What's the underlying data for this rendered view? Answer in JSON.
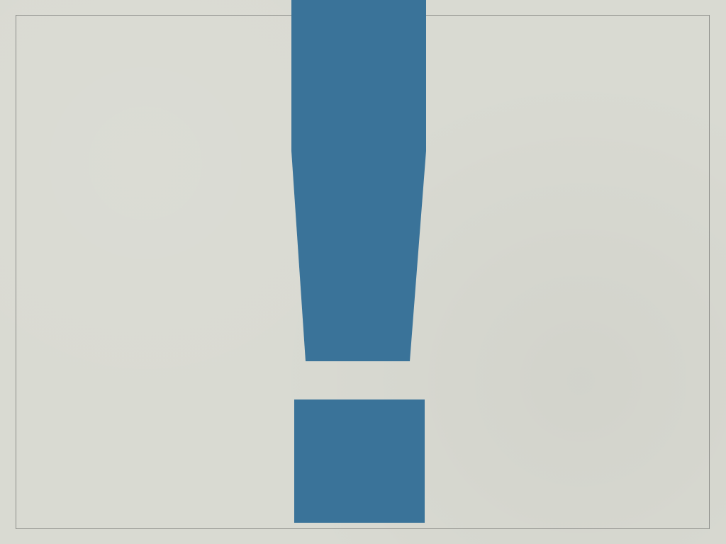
{
  "slide": {
    "background_color": "#d9dad2",
    "frame_color": "#8e8f8b",
    "graphic": {
      "icon": "exclamation-mark-icon",
      "color": "#3a7399"
    }
  }
}
